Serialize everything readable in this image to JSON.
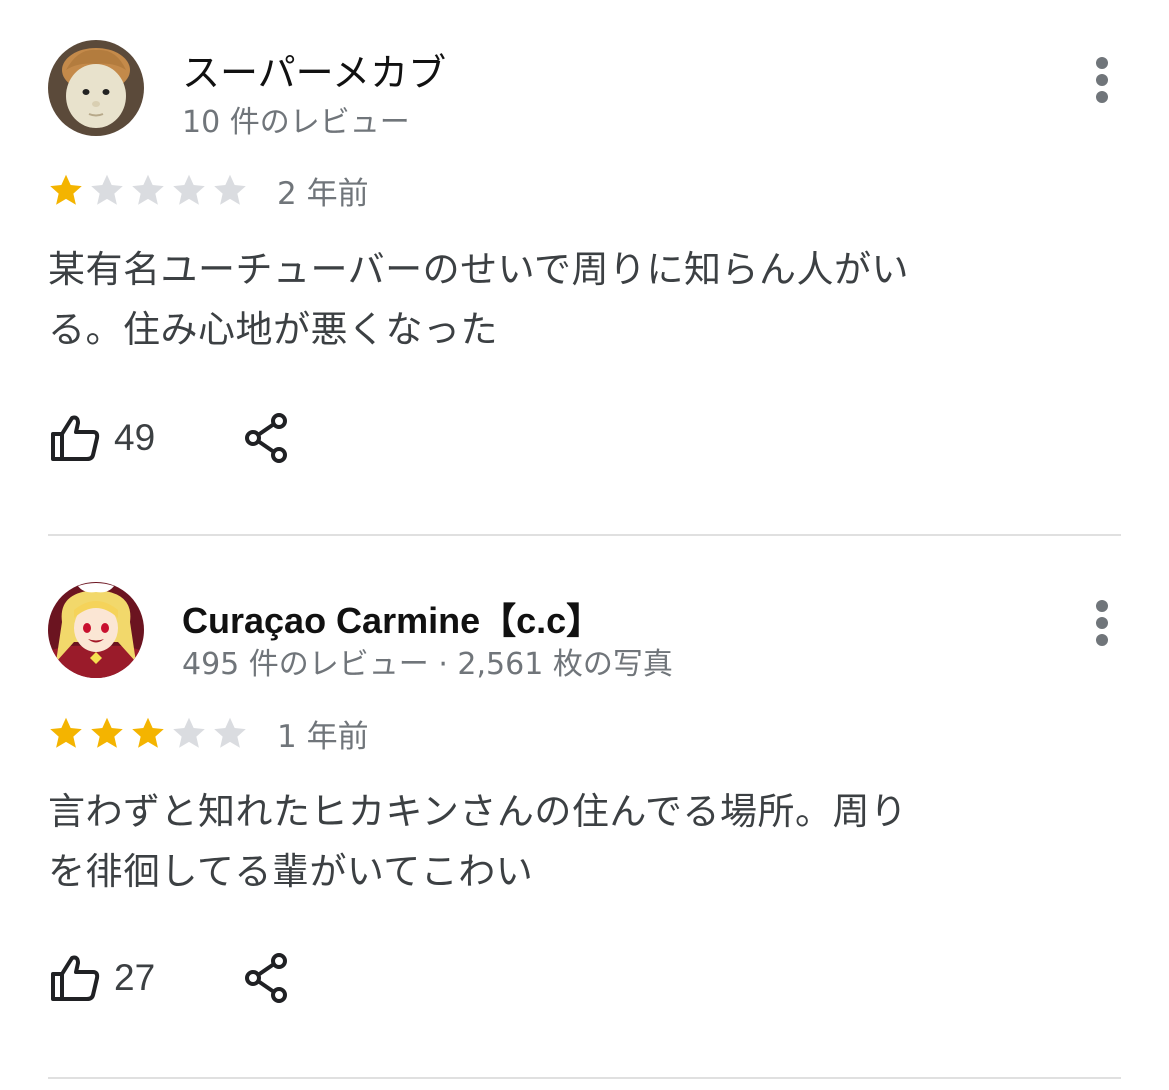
{
  "reviews": [
    {
      "reviewer_name": "スーパーメカブ",
      "reviewer_meta": "10 件のレビュー",
      "rating": 1,
      "max_rating": 5,
      "time_ago": "2 年前",
      "text_line1": "某有名ユーチューバーのせいで周りに知らん人がい",
      "text_line2": "る。住み心地が悪くなった",
      "like_count": "49",
      "avatar_icon": "doll-face-avatar"
    },
    {
      "reviewer_name": "Curaçao Carmine【c.c】",
      "reviewer_meta": "495 件のレビュー · 2,561 枚の写真",
      "rating": 3,
      "max_rating": 5,
      "time_ago": "1 年前",
      "text_line1": "言わずと知れたヒカキンさんの住んでる場所。周り",
      "text_line2": "を徘徊してる輩がいてこわい",
      "like_count": "27",
      "avatar_icon": "anime-character-avatar"
    }
  ],
  "colors": {
    "star_filled": "#f4b400",
    "star_empty": "#dadce0",
    "secondary_text": "#70757a",
    "body_text": "#3c4043",
    "divider": "#e0e0e0"
  },
  "icons": {
    "like": "thumbs-up-icon",
    "share": "share-icon",
    "more": "more-vert-icon",
    "star": "star-icon"
  }
}
